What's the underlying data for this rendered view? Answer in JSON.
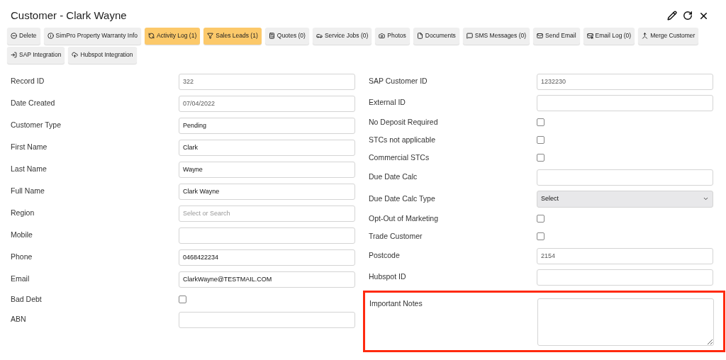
{
  "title": "Customer - Clark Wayne",
  "toolbar": [
    {
      "label": "Delete",
      "highlighted": false
    },
    {
      "label": "SimPro Property Warranty Info",
      "highlighted": false
    },
    {
      "label": "Activity Log (1)",
      "highlighted": true
    },
    {
      "label": "Sales Leads (1)",
      "highlighted": true
    },
    {
      "label": "Quotes (0)",
      "highlighted": false
    },
    {
      "label": "Service Jobs (0)",
      "highlighted": false
    },
    {
      "label": "Photos",
      "highlighted": false
    },
    {
      "label": "Documents",
      "highlighted": false
    },
    {
      "label": "SMS Messages (0)",
      "highlighted": false
    },
    {
      "label": "Send Email",
      "highlighted": false
    },
    {
      "label": "Email Log (0)",
      "highlighted": false
    },
    {
      "label": "Merge Customer",
      "highlighted": false
    },
    {
      "label": "SAP Integration",
      "highlighted": false
    },
    {
      "label": "Hubspot Integration",
      "highlighted": false
    }
  ],
  "left_fields": [
    {
      "label": "Record ID",
      "kind": "text",
      "value": "322",
      "readonly": true
    },
    {
      "label": "Date Created",
      "kind": "text",
      "value": "07/04/2022",
      "readonly": true
    },
    {
      "label": "Customer Type",
      "kind": "text",
      "value": "Pending",
      "readonly": false
    },
    {
      "label": "First Name",
      "kind": "text",
      "value": "Clark",
      "readonly": false
    },
    {
      "label": "Last Name",
      "kind": "text",
      "value": "Wayne",
      "readonly": false
    },
    {
      "label": "Full Name",
      "kind": "text",
      "value": "Clark Wayne",
      "readonly": false
    },
    {
      "label": "Region",
      "kind": "text",
      "placeholder": "Select or Search"
    },
    {
      "label": "Mobile",
      "kind": "text"
    },
    {
      "label": "Phone",
      "kind": "text",
      "value": "0468422234",
      "readonly": false
    },
    {
      "label": "Email",
      "kind": "text",
      "value": "ClarkWayne@TESTMAIL.COM",
      "readonly": false
    },
    {
      "label": "Bad Debt",
      "kind": "checkbox",
      "checked": false
    },
    {
      "label": "ABN",
      "kind": "text"
    }
  ],
  "right_fields": [
    {
      "label": "SAP Customer ID",
      "kind": "text",
      "value": "1232230",
      "readonly": true
    },
    {
      "label": "External ID",
      "kind": "text"
    },
    {
      "label": "No Deposit Required",
      "kind": "checkbox",
      "checked": false
    },
    {
      "label": "STCs not applicable",
      "kind": "checkbox",
      "checked": false
    },
    {
      "label": "Commercial STCs",
      "kind": "checkbox",
      "checked": false
    },
    {
      "label": "Due Date Calc",
      "kind": "text"
    },
    {
      "label": "Due Date Calc Type",
      "kind": "select",
      "value": "Select"
    },
    {
      "label": "Opt-Out of Marketing",
      "kind": "checkbox",
      "checked": false
    },
    {
      "label": "Trade Customer",
      "kind": "checkbox",
      "checked": false
    },
    {
      "label": "Postcode",
      "kind": "text",
      "value": "2154",
      "readonly": true
    },
    {
      "label": "Hubspot ID",
      "kind": "text"
    },
    {
      "label": "Important Notes",
      "kind": "textarea",
      "outlined": true
    }
  ]
}
